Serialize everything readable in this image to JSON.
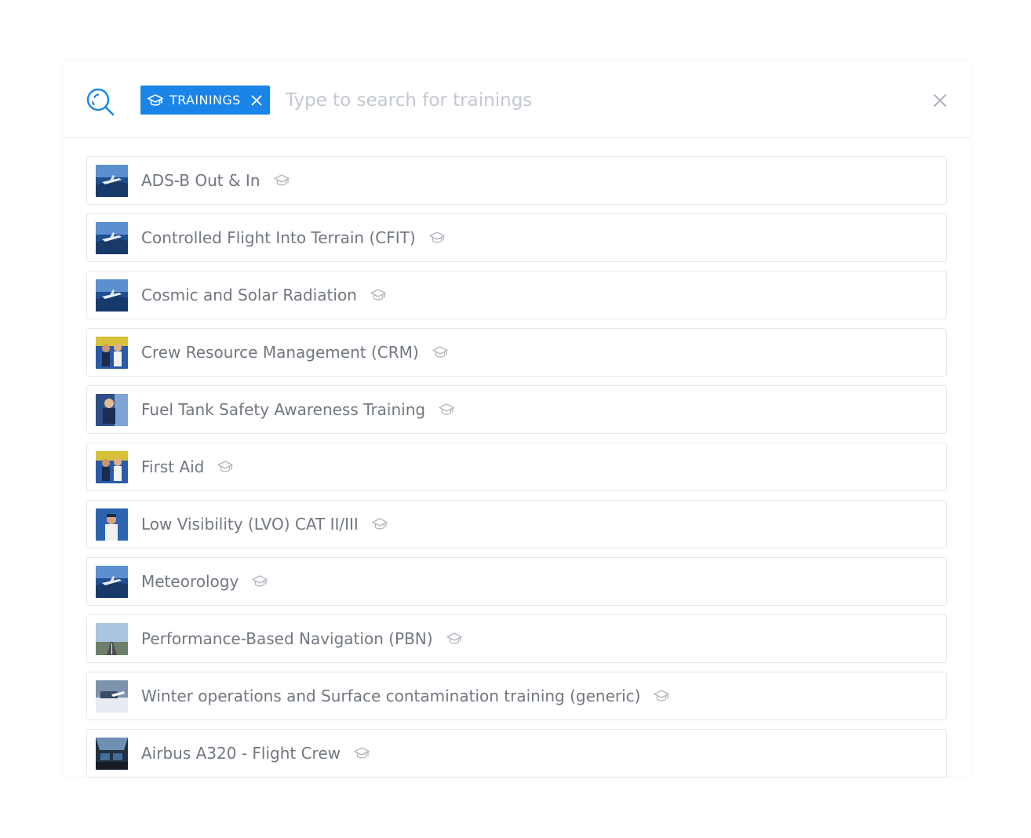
{
  "search": {
    "filter_chip_label": "TRAININGS",
    "placeholder": "Type to search for trainings",
    "value": ""
  },
  "colors": {
    "accent": "#1a84e8",
    "item_text": "#717780",
    "placeholder": "#c3c8d0",
    "border": "#e4e7ec"
  },
  "icons": {
    "search": "search-icon",
    "chip_type": "graduation-cap-icon",
    "chip_remove": "close-icon",
    "clear": "close-icon",
    "item_type": "graduation-cap-icon"
  },
  "results": [
    {
      "title": "ADS-B Out & In",
      "thumb": "aircraft-thumbnail"
    },
    {
      "title": "Controlled Flight Into Terrain (CFIT)",
      "thumb": "aircraft-thumbnail"
    },
    {
      "title": "Cosmic and Solar Radiation",
      "thumb": "aircraft-thumbnail"
    },
    {
      "title": "Crew Resource Management (CRM)",
      "thumb": "crew-thumbnail"
    },
    {
      "title": "Fuel Tank Safety Awareness Training",
      "thumb": "technician-thumbnail"
    },
    {
      "title": "First Aid",
      "thumb": "crew-thumbnail"
    },
    {
      "title": "Low Visibility (LVO) CAT II/III",
      "thumb": "pilot-thumbnail"
    },
    {
      "title": "Meteorology",
      "thumb": "aircraft-thumbnail"
    },
    {
      "title": "Performance-Based Navigation (PBN)",
      "thumb": "runway-thumbnail"
    },
    {
      "title": "Winter operations and Surface contamination training (generic)",
      "thumb": "airport-thumbnail"
    },
    {
      "title": "Airbus A320 - Flight Crew",
      "thumb": "cockpit-thumbnail"
    }
  ]
}
